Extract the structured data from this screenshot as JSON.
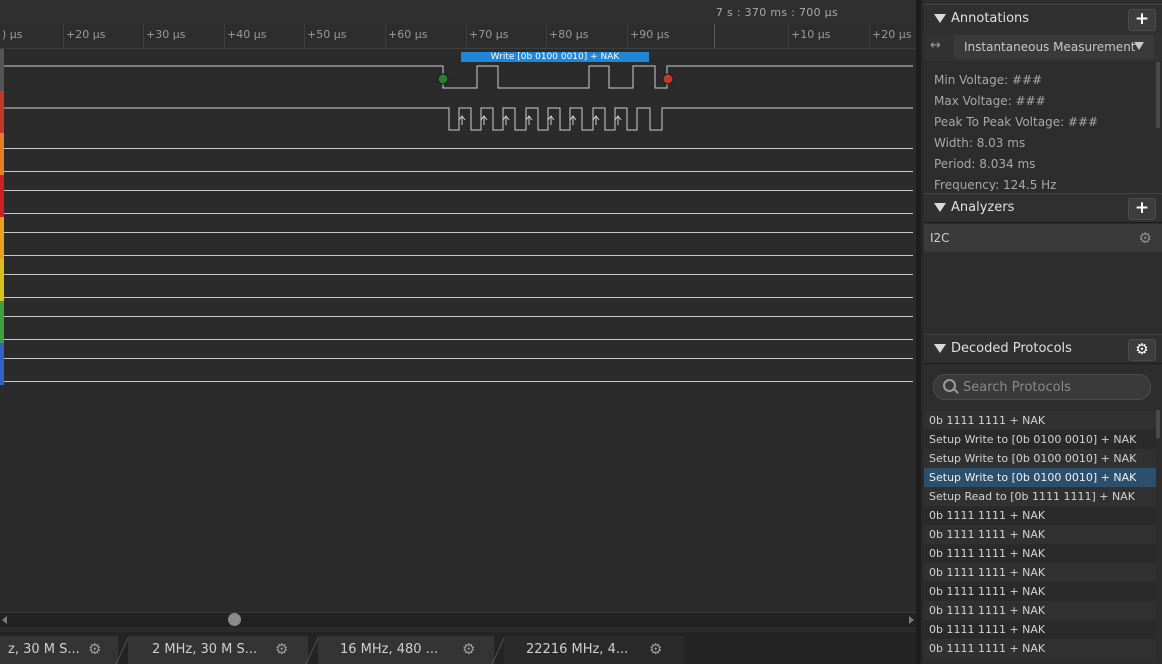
{
  "topbar": {
    "time_readout": "7 s : 370 ms : 700 µs"
  },
  "ruler": {
    "ticks": [
      ") µs",
      "+20 µs",
      "+30 µs",
      "+40 µs",
      "+50 µs",
      "+60 µs",
      "+70 µs",
      "+80 µs",
      "+90 µs",
      "+10 µs",
      "+20 µs"
    ]
  },
  "waveform": {
    "bubble_label": "Write [0b  0100  0010] + NAK",
    "channel_colors": [
      "#555555",
      "#c0392b",
      "#e67e22",
      "#cc2222",
      "#e8a020",
      "#d8c020",
      "#3ea03e",
      "#3060c8",
      "#8a3dbf"
    ],
    "start_marker_color": "#2e7d32",
    "stop_marker_color": "#c0392b",
    "bubble_color": "#1f86d8"
  },
  "tabs": [
    {
      "label": "z, 30 M S...",
      "active": false
    },
    {
      "label": "2 MHz, 30 M S...",
      "active": false
    },
    {
      "label": "16 MHz, 480 ...",
      "active": false
    },
    {
      "label": "22216 MHz, 4...",
      "active": true
    }
  ],
  "annotations": {
    "title": "Annotations",
    "add_label": "+",
    "measurement_select": "Instantaneous Measurement",
    "lines": [
      "Min Voltage: ###",
      "Max Voltage: ###",
      "Peak To Peak Voltage: ###",
      "Width: 8.03 ms",
      "Period: 8.034 ms",
      "Frequency: 124.5 Hz"
    ]
  },
  "analyzers": {
    "title": "Analyzers",
    "add_label": "+",
    "items": [
      {
        "label": "I2C"
      }
    ]
  },
  "decoded": {
    "title": "Decoded Protocols",
    "search_placeholder": "Search Protocols",
    "selected_index": 3,
    "rows": [
      "0b  1111  1111 + NAK",
      "Setup Write to [0b  0100  0010] + NAK",
      "Setup Write to [0b  0100  0010] + NAK",
      "Setup Write to [0b  0100  0010] + NAK",
      "Setup Read to [0b  1111  1111] + NAK",
      "0b  1111  1111 + NAK",
      "0b  1111  1111 + NAK",
      "0b  1111  1111 + NAK",
      "0b  1111  1111 + NAK",
      "0b  1111  1111 + NAK",
      "0b  1111  1111 + NAK",
      "0b  1111  1111 + NAK",
      "0b  1111  1111 + NAK"
    ]
  }
}
